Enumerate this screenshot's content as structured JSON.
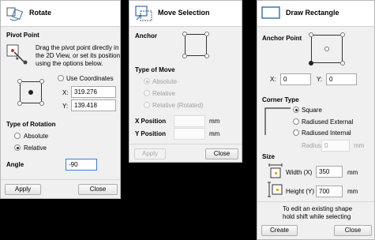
{
  "rotate": {
    "title": "Rotate",
    "pivot_point_heading": "Pivot Point",
    "pivot_help": [
      "Drag the pivot point directly in",
      "the 2D View, or set its position",
      "using the options below."
    ],
    "use_coordinates_label": "Use Coordinates",
    "x_label": "X:",
    "x_value": "319.276",
    "y_label": "Y:",
    "y_value": "139.418",
    "type_of_rotation_heading": "Type of Rotation",
    "absolute_label": "Absolute",
    "relative_label": "Relative",
    "angle_label": "Angle",
    "angle_value": "-90",
    "apply_label": "Apply",
    "close_label": "Close"
  },
  "move": {
    "title": "Move Selection",
    "anchor_heading": "Anchor",
    "type_of_move_heading": "Type of Move",
    "absolute_label": "Absolute",
    "relative_label": "Relative",
    "relative_rotated_label": "Relative (Rotated)",
    "x_position_label": "X Position",
    "y_position_label": "Y Position",
    "unit_x": "mm",
    "unit_y": "mm",
    "apply_label": "Apply",
    "close_label": "Close"
  },
  "rect": {
    "title": "Draw Rectangle",
    "anchor_point_heading": "Anchor Point",
    "x_label": "X:",
    "x_value": "0",
    "y_label": "Y:",
    "y_value": "0",
    "corner_type_heading": "Corner Type",
    "square_label": "Square",
    "radiused_external_label": "Radiused External",
    "radiused_internal_label": "Radiused Internal",
    "radius_label": "Radius",
    "radius_value": "0",
    "radius_unit": "mm",
    "size_heading": "Size",
    "width_label": "Width (X)",
    "width_value": "350",
    "width_unit": "mm",
    "height_label": "Height (Y)",
    "height_value": "700",
    "height_unit": "mm",
    "hint_line1": "To edit an existing shape",
    "hint_line2": "hold shift while selecting",
    "create_label": "Create",
    "close_label": "Close"
  },
  "colors": {
    "background": "#000000",
    "panel": "#f0f0f0",
    "header": "#ffffff",
    "icon_accent": "#2f6db5",
    "pivot_red": "#d03030"
  }
}
